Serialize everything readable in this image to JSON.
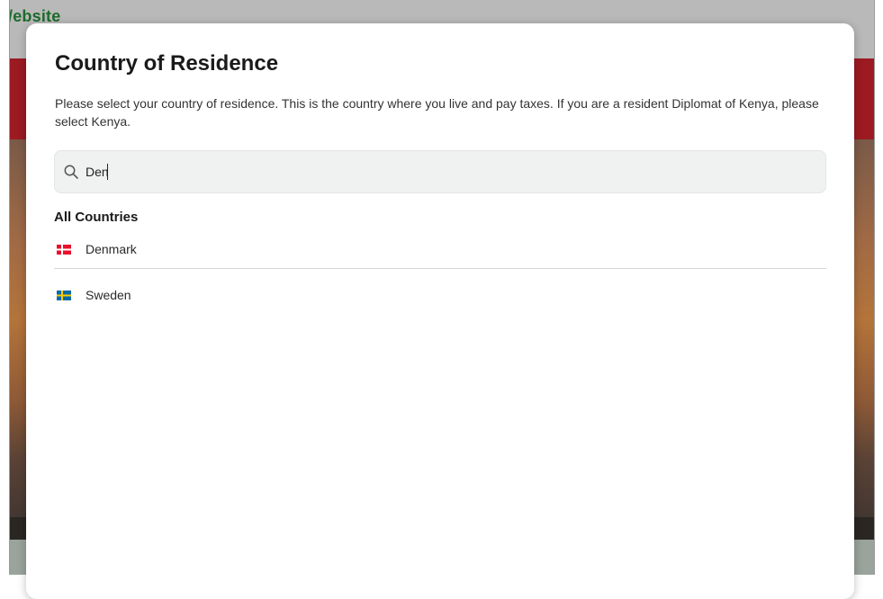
{
  "background": {
    "site_title": "/ebsite",
    "colors": {
      "top_bar": "#b9b9b9",
      "red_band": "#9c1a22",
      "title_green": "#1e6b2c"
    }
  },
  "modal": {
    "title": "Country of Residence",
    "description": "Please select your country of residence. This is the country where you live and pay taxes. If you are a resident Diplomat of Kenya, please select Kenya.",
    "search": {
      "icon": "search-icon",
      "value": "Den",
      "placeholder": ""
    },
    "section_heading": "All Countries",
    "countries": [
      {
        "name": "Denmark",
        "flag": "denmark-flag-icon",
        "colors": {
          "field": "#e8112d",
          "cross": "#ffffff"
        }
      },
      {
        "name": "Sweden",
        "flag": "sweden-flag-icon",
        "colors": {
          "field": "#006aa7",
          "cross": "#fecc00"
        }
      }
    ]
  }
}
